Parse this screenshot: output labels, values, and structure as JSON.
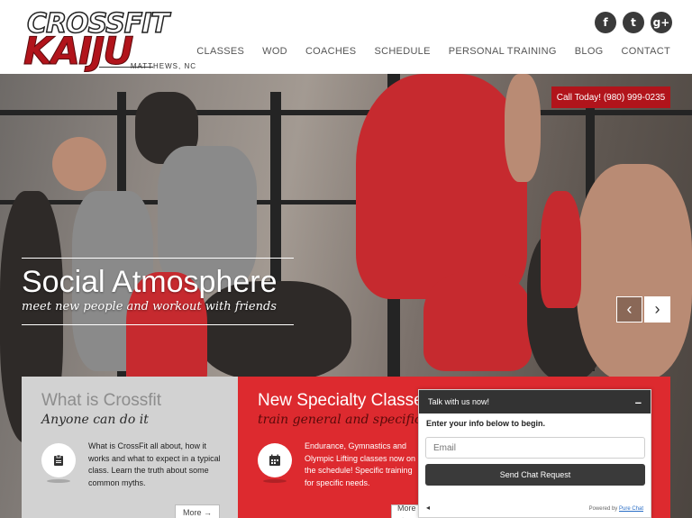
{
  "logo": {
    "top": "CROSSFIT",
    "bottom": "KAIJU",
    "sub": "MATTHEWS, NC"
  },
  "social": [
    {
      "icon": "facebook-icon",
      "glyph": "f"
    },
    {
      "icon": "twitter-icon",
      "glyph": "t"
    },
    {
      "icon": "google-plus-icon",
      "glyph": "g+"
    }
  ],
  "nav": [
    "CLASSES",
    "WOD",
    "COACHES",
    "SCHEDULE",
    "PERSONAL TRAINING",
    "BLOG",
    "CONTACT"
  ],
  "call_button": "Call Today! (980) 999-0235",
  "slide": {
    "title": "Social Atmosphere",
    "subtitle": "meet new people and workout with friends",
    "prev": "‹",
    "next": "›"
  },
  "cards": [
    {
      "title": "What is Crossfit",
      "subtitle": "Anyone can do it",
      "icon": "clipboard-icon",
      "description": "What is CrossFit all about, how it works and what to expect in a typical class. Learn the truth about some common myths.",
      "more": "More →"
    },
    {
      "title": "New Specialty Classes",
      "subtitle": "train general and specific",
      "icon": "calendar-icon",
      "description": "Endurance, Gymnastics and Olympic Lifting classes now on the schedule! Specific training for specific needs.",
      "more": "More →"
    }
  ],
  "chat": {
    "title": "Talk with us now!",
    "minimize": "–",
    "prompt": "Enter your info below to begin.",
    "email_placeholder": "Email",
    "send": "Send Chat Request",
    "powered_by": "Powered by",
    "brand": "Pure Chat",
    "sound_icon": "◂"
  },
  "colors": {
    "brand_red": "#b1141b",
    "card_red": "#dd2a2f",
    "card_grey": "#d2d2d2",
    "chat_dark": "#333333"
  }
}
